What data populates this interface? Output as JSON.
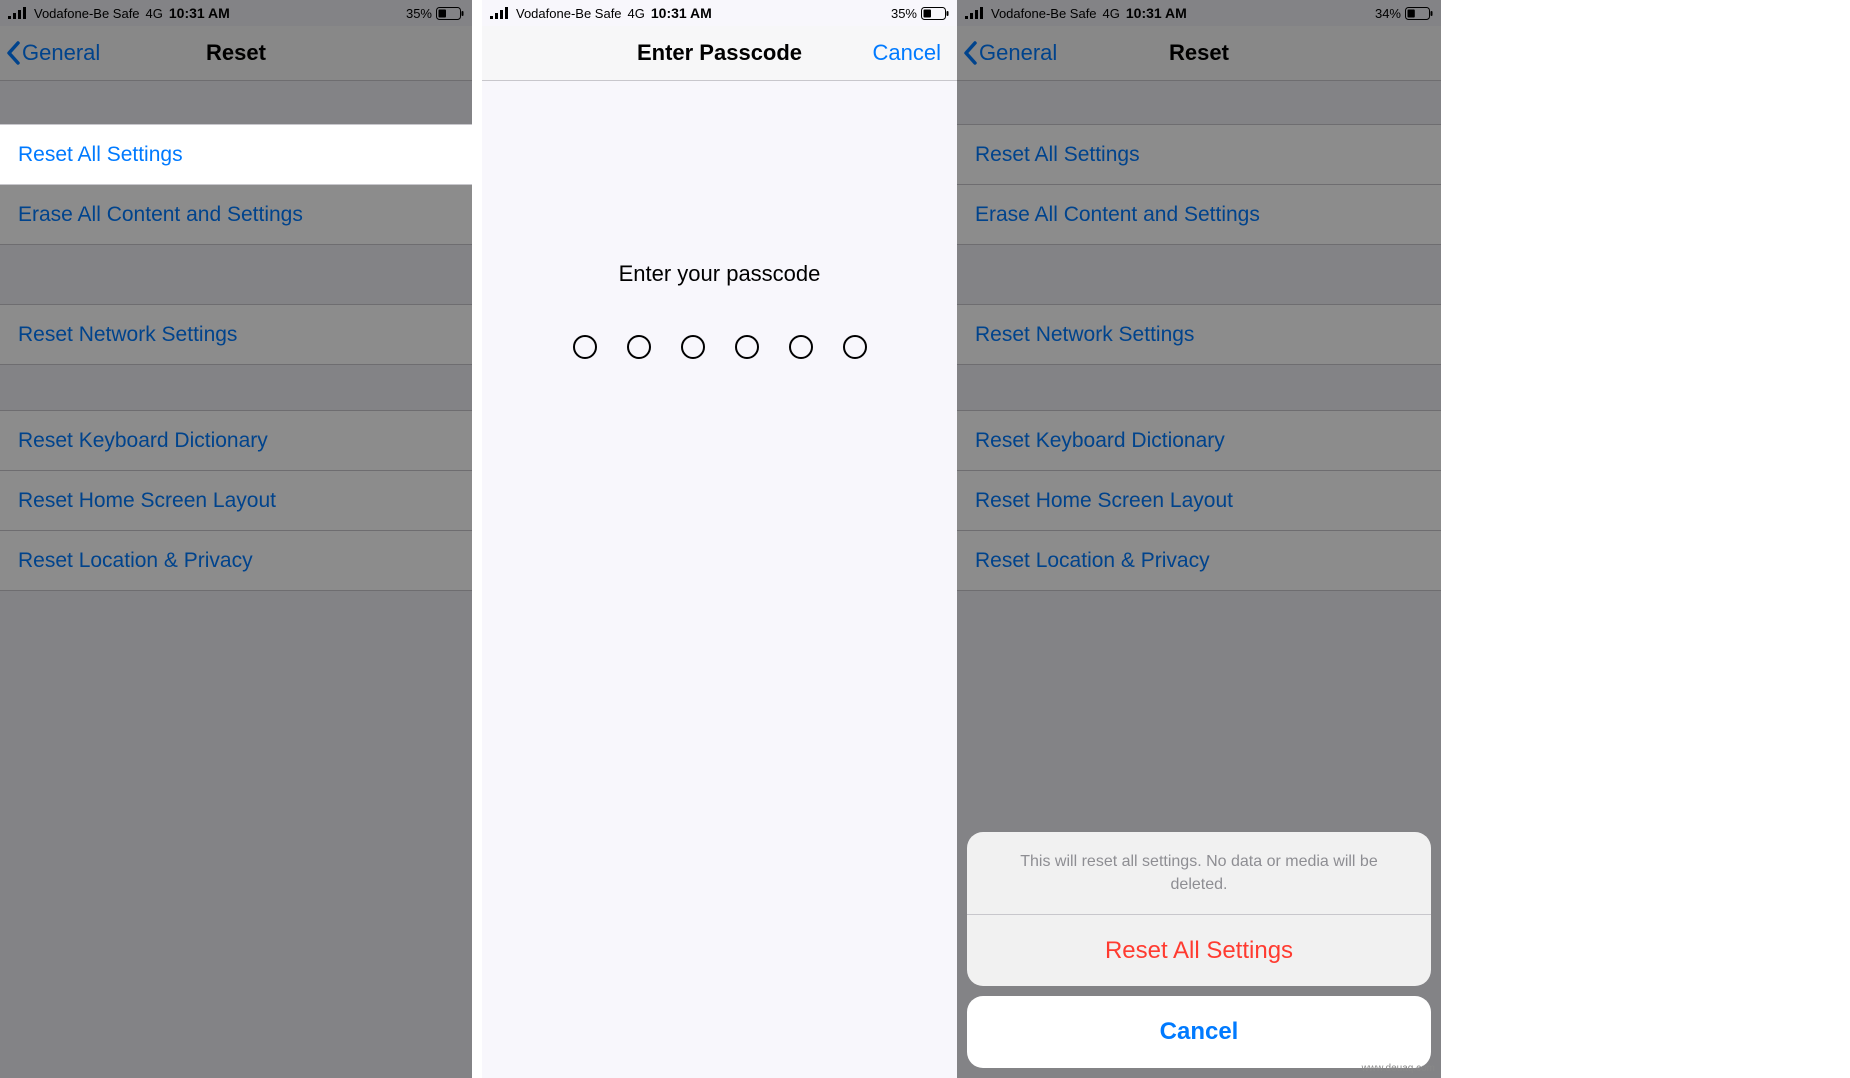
{
  "status": {
    "carrier": "Vodafone-Be Safe",
    "network": "4G",
    "time": "10:31 AM",
    "battery_a": "35%",
    "battery_b": "35%",
    "battery_c": "34%"
  },
  "nav": {
    "back_label": "General",
    "title_reset": "Reset",
    "title_passcode": "Enter Passcode",
    "cancel": "Cancel"
  },
  "reset_list": {
    "reset_all": "Reset All Settings",
    "erase_all": "Erase All Content and Settings",
    "reset_network": "Reset Network Settings",
    "reset_keyboard": "Reset Keyboard Dictionary",
    "reset_home": "Reset Home Screen Layout",
    "reset_location": "Reset Location & Privacy"
  },
  "passcode": {
    "prompt": "Enter your passcode"
  },
  "sheet": {
    "message": "This will reset all settings. No data or media will be deleted.",
    "confirm": "Reset All Settings",
    "cancel": "Cancel"
  },
  "watermark": "www.deuaq.com"
}
